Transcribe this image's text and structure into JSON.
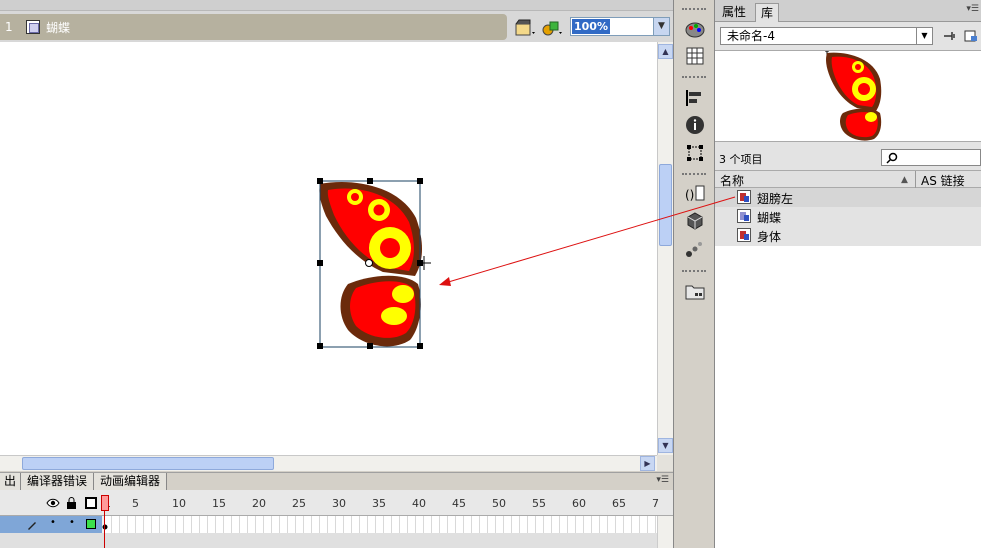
{
  "scene": {
    "number": "1",
    "name": "蝴蝶"
  },
  "zoom": {
    "value": "100%"
  },
  "timeline": {
    "tabs": [
      "出",
      "编译器错误",
      "动画编辑器"
    ],
    "frame_numbers": [
      "1",
      "5",
      "10",
      "15",
      "20",
      "25",
      "30",
      "35",
      "40",
      "45",
      "50",
      "55",
      "60",
      "65",
      "7"
    ]
  },
  "library": {
    "tabs": {
      "properties": "属性",
      "library": "库"
    },
    "document": "未命名-4",
    "count": "3 个项目",
    "columns": {
      "name": "名称",
      "linkage": "AS 链接"
    },
    "items": [
      {
        "label": "翅膀左",
        "type": "graphic",
        "selected": true
      },
      {
        "label": "蝴蝶",
        "type": "movie-clip",
        "selected": false
      },
      {
        "label": "身体",
        "type": "graphic",
        "selected": false
      }
    ]
  },
  "colors": {
    "scene_bar": "#b6b19f",
    "wing_outer": "#6b2a0b",
    "wing_fill": "#ff0000",
    "spot": "#ffff00",
    "arrow": "#dd1111",
    "selection_layer": "#7fa6d7"
  }
}
